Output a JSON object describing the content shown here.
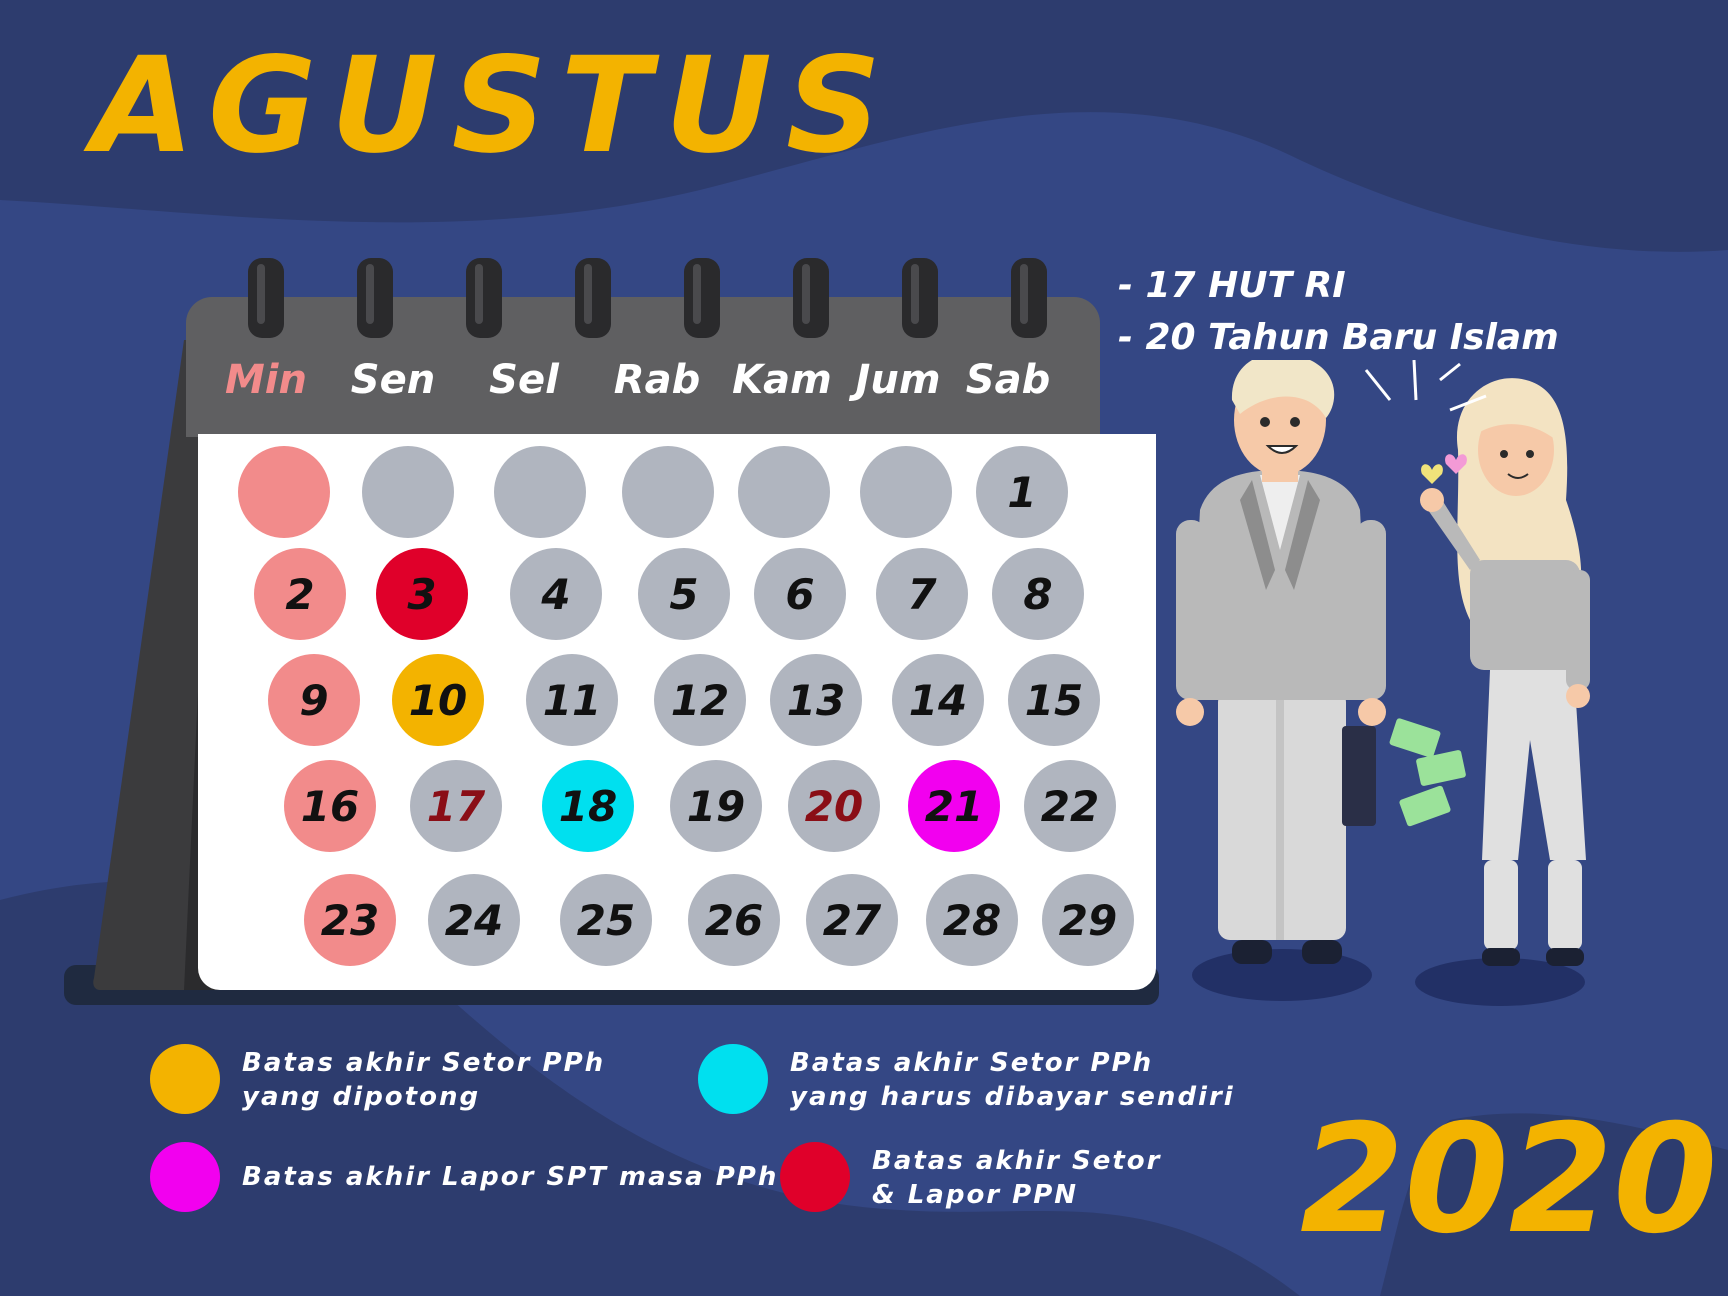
{
  "title": "AGUSTUS",
  "year": "2020",
  "holidays": [
    "- 17 HUT RI",
    "- 20 Tahun Baru Islam"
  ],
  "weekdays": [
    "Min",
    "Sen",
    "Sel",
    "Rab",
    "Kam",
    "Jum",
    "Sab"
  ],
  "days": [
    "",
    "",
    "",
    "",
    "",
    "",
    "1",
    "2",
    "3",
    "4",
    "5",
    "6",
    "7",
    "8",
    "9",
    "10",
    "11",
    "12",
    "13",
    "14",
    "15",
    "16",
    "17",
    "18",
    "19",
    "20",
    "21",
    "22",
    "23",
    "24",
    "25",
    "26",
    "27",
    "28",
    "29"
  ],
  "colors": {
    "sunday": "#f28b8b",
    "normal": "#b0b5bf",
    "setor_pph_dipotong": "#f3b300",
    "setor_pph_sendiri": "#00e0ef",
    "lapor_spt": "#f200ef",
    "setor_lapor_ppn": "#e0002a",
    "title": "#f3b300",
    "background": "#344784"
  },
  "legend": [
    {
      "lines": [
        "Batas akhir Setor PPh",
        "yang dipotong"
      ],
      "color": "#f3b300"
    },
    {
      "lines": [
        "Batas akhir Setor PPh",
        "yang harus dibayar sendiri"
      ],
      "color": "#00e0ef"
    },
    {
      "lines": [
        "Batas akhir Lapor SPT masa PPh"
      ],
      "color": "#f200ef"
    },
    {
      "lines": [
        "Batas akhir Setor",
        "& Lapor PPN"
      ],
      "color": "#e0002a"
    }
  ]
}
